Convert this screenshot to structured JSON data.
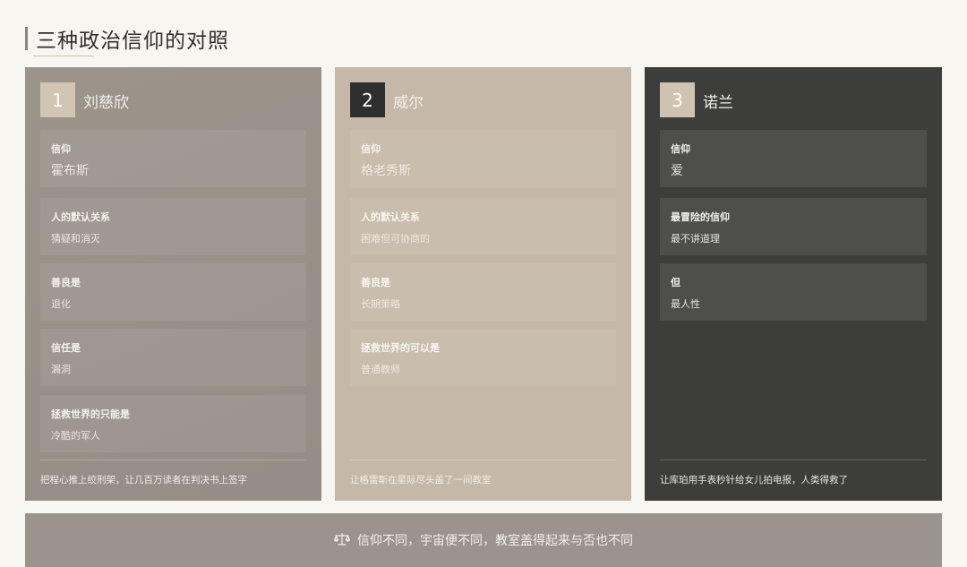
{
  "title": "三种政治信仰的对照",
  "cards": [
    {
      "number": "1",
      "name": "刘慈欣",
      "items": [
        {
          "label": "信仰",
          "value": "霍布斯"
        },
        {
          "label": "人的默认关系",
          "value": "猜疑和消灭"
        },
        {
          "label": "善良是",
          "value": "退化"
        },
        {
          "label": "信任是",
          "value": "漏洞"
        },
        {
          "label": "拯救世界的只能是",
          "value": "冷酷的军人"
        }
      ],
      "footer": "把程心推上绞刑架，让几百万读者在判决书上签字"
    },
    {
      "number": "2",
      "name": "威尔",
      "items": [
        {
          "label": "信仰",
          "value": "格老秀斯"
        },
        {
          "label": "人的默认关系",
          "value": "困难但可协商的"
        },
        {
          "label": "善良是",
          "value": "长期策略"
        },
        {
          "label": "拯救世界的可以是",
          "value": "普通教师"
        }
      ],
      "footer": "让格雷斯在星际尽头盖了一间教室"
    },
    {
      "number": "3",
      "name": "诺兰",
      "items": [
        {
          "label": "信仰",
          "value": "爱"
        },
        {
          "label": "最冒险的信仰",
          "value": "最不讲道理"
        },
        {
          "label": "但",
          "value": "最人性"
        }
      ],
      "footer": "让库珀用手表秒针给女儿拍电报，人类得救了"
    }
  ],
  "banner": {
    "icon": "scale-icon",
    "text": "信仰不同，宇宙便不同，教室盖得起来与否也不同"
  }
}
